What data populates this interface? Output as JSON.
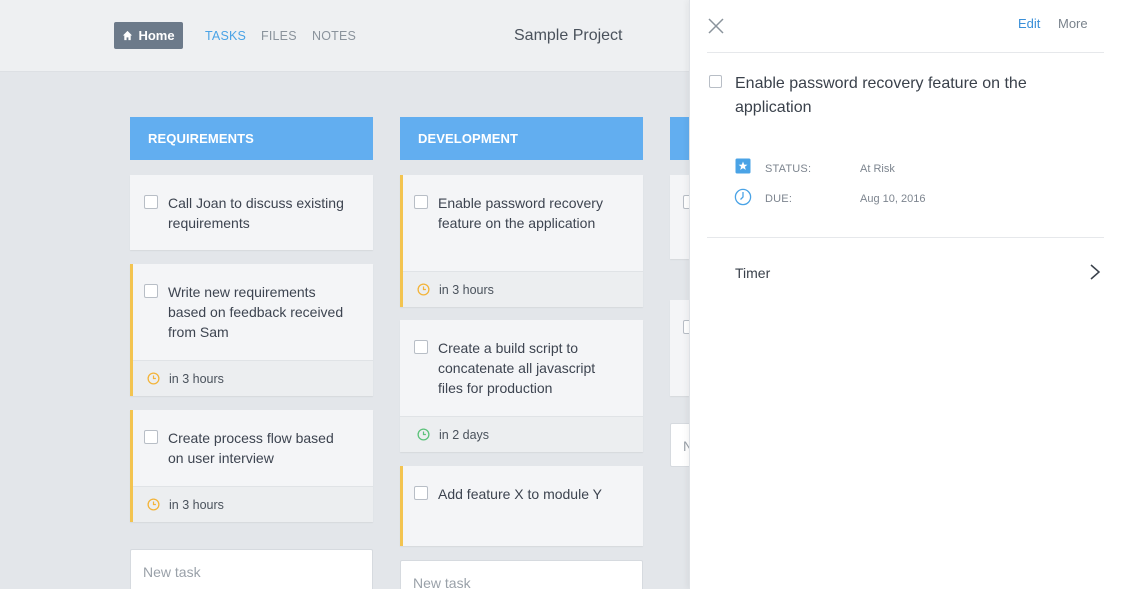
{
  "header": {
    "home_label": "Home",
    "nav": {
      "tasks": "TASKS",
      "files": "FILES",
      "notes": "NOTES"
    },
    "project_title": "Sample Project"
  },
  "columns": [
    {
      "title": "REQUIREMENTS",
      "cards": [
        {
          "text": "Call Joan to discuss existing requirements",
          "due": "",
          "accent": false
        },
        {
          "text": "Write new requirements based on feedback received from Sam",
          "due": "in 3 hours",
          "accent": true
        },
        {
          "text": "Create process flow based on user interview",
          "due": "in 3 hours",
          "accent": true
        }
      ],
      "new_task_placeholder": "New task"
    },
    {
      "title": "DEVELOPMENT",
      "cards": [
        {
          "text": "Enable password recovery feature on the application",
          "due": "in 3 hours",
          "accent": true
        },
        {
          "text": "Create a build script to concatenate all javascript files for production",
          "due": "in 2 days",
          "accent": false
        },
        {
          "text": "Add feature X to module Y",
          "due": "",
          "accent": true
        }
      ],
      "new_task_placeholder": "New task"
    },
    {
      "title": "",
      "cards": [],
      "new_task_placeholder": "N"
    }
  ],
  "colors": {
    "column_header": "#62aef0",
    "accent": "#f3c450",
    "clock_soon": "#f3b43a",
    "clock_later": "#5cc27a",
    "link": "#3a8fd8"
  },
  "panel": {
    "edit_label": "Edit",
    "more_label": "More",
    "title": "Enable password recovery feature on the application",
    "status_label": "STATUS:",
    "status_value": "At Risk",
    "due_label": "DUE:",
    "due_value": "Aug 10, 2016",
    "timer_label": "Timer"
  }
}
